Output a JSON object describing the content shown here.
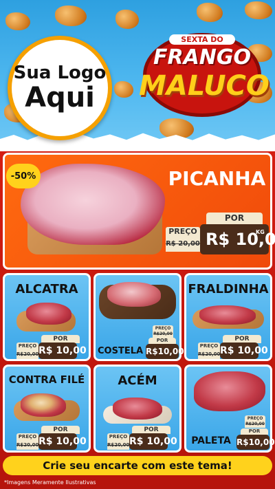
{
  "logo": {
    "line1": "Sua Logo",
    "line2": "Aqui"
  },
  "campaign": {
    "subtitle": "SEXTA DO",
    "title1": "FRANGO",
    "title2": "MALUCO"
  },
  "featured": {
    "discount": "-50%",
    "name": "PICANHA",
    "por_label": "POR",
    "preco_label": "PREÇO",
    "old_price": "R$ 20,00",
    "new_price": "R$ 10,00",
    "unit": "KG"
  },
  "products": [
    {
      "name": "ALCATRA",
      "por_label": "POR",
      "preco_label": "PREÇO",
      "old_price": "R$20,00",
      "new_price": "R$ 10,00",
      "unit": "KG"
    },
    {
      "name": "COSTELA",
      "por_label": "POR",
      "preco_label": "PREÇO",
      "old_price": "R$20,00",
      "new_price": "R$10,00",
      "unit": "KG"
    },
    {
      "name": "FRALDINHA",
      "por_label": "POR",
      "preco_label": "PREÇO",
      "old_price": "R$20,00",
      "new_price": "R$ 10,00",
      "unit": "KG"
    },
    {
      "name": "CONTRA FILÉ",
      "por_label": "POR",
      "preco_label": "PREÇO",
      "old_price": "R$20,00",
      "new_price": "R$ 10,00",
      "unit": "KG"
    },
    {
      "name": "ACÉM",
      "por_label": "POR",
      "preco_label": "PREÇO",
      "old_price": "R$20,00",
      "new_price": "R$ 10,00",
      "unit": "KG"
    },
    {
      "name": "PALETA",
      "por_label": "POR",
      "preco_label": "PREÇO",
      "old_price": "R$20,00",
      "new_price": "R$10,00",
      "unit": "KG"
    }
  ],
  "cta": "Crie seu encarte com este tema!",
  "footnote": "*Imagens Meramente Ilustrativas",
  "colors": {
    "primary_red": "#d51e12",
    "orange": "#f05a0c",
    "yellow": "#ffd21c",
    "card_blue": "#4fb4ee",
    "price_brown": "#4a2c1a"
  }
}
